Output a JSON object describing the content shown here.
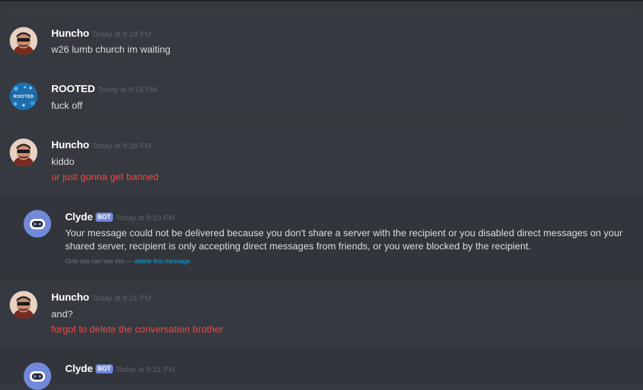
{
  "messages": [
    {
      "author": "Huncho",
      "timestamp": "Today at 8:18 PM",
      "lines": [
        "w26 lumb church im waiting"
      ]
    },
    {
      "author": "ROOTED",
      "timestamp": "Today at 8:18 PM",
      "avatar_text": "ROOTED",
      "lines": [
        "fuck off"
      ]
    },
    {
      "author": "Huncho",
      "timestamp": "Today at 8:18 PM",
      "lines": [
        "kiddo"
      ],
      "failed_lines": [
        "ur just gonna get banned"
      ]
    },
    {
      "author": "Clyde",
      "badge": "BOT",
      "timestamp": "Today at 8:19 PM",
      "text": "Your message could not be delivered because you don't share a server with the recipient or you disabled direct messages on your shared server, recipient is only accepting direct messages from friends, or you were blocked by the recipient.",
      "ephemeral_note": "Only you can see this —",
      "ephemeral_link": "delete this message."
    },
    {
      "author": "Huncho",
      "timestamp": "Today at 8:21 PM",
      "lines": [
        "and?"
      ],
      "failed_lines": [
        "forgot to delete the conversation brother"
      ]
    },
    {
      "author": "Clyde",
      "badge": "BOT",
      "timestamp": "Today at 8:21 PM"
    }
  ],
  "colors": {
    "background": "#36393f",
    "bot_message_bg": "#32353b",
    "failed_text": "#f04747",
    "bot_badge": "#7289da",
    "link": "#00b0f4"
  },
  "icons": {
    "huncho_avatar": "avatar-huncho",
    "rooted_avatar": "avatar-rooted",
    "clyde_avatar": "avatar-clyde-robot"
  }
}
